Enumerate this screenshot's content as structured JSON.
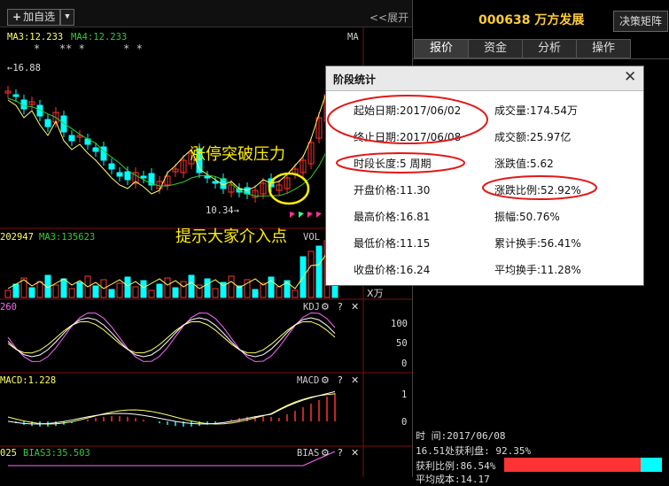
{
  "toolbar": {
    "add_watch_label": "加自选",
    "add_watch_icon": "plus-icon",
    "expand_label": "<<展开"
  },
  "stock": {
    "code": "000638",
    "name": "万方发展",
    "decision_button": "决策矩阵"
  },
  "tabs": [
    "报价",
    "资金",
    "分析",
    "操作"
  ],
  "chart": {
    "ma_labels": {
      "ma3": "MA3:12.233",
      "ma4": "MA4:12.233",
      "ma_tag": "MA"
    },
    "markers": "*   ** *      * *",
    "high_label": "16.88",
    "low_label": "10.34",
    "vol_tag": "VOL",
    "vol_left": "202947",
    "vol_ma3": "MA3:135623",
    "vol_unit": "X万",
    "kdj_left": "260",
    "kdj_tag": "KDJ",
    "kdj_scale": [
      "100",
      "50",
      "0"
    ],
    "macd_left": "MACD:1.228",
    "macd_tag": "MACD",
    "macd_scale": [
      "1",
      "0"
    ],
    "bias_left": "025",
    "bias3": "BIAS3:35.503",
    "bias_tag": "BIAS",
    "ctl_icons": [
      "gear-icon",
      "help-icon",
      "close-icon"
    ],
    "ctl_glyphs": {
      "help": "?",
      "close": "✕"
    },
    "colors": {
      "up": "#ff3333",
      "down": "#00ffff",
      "ma_a": "#ffff66",
      "ma_b": "#33cc33"
    }
  },
  "annotations": {
    "breakout": "涨停突破压力",
    "entry": "提示大家介入点"
  },
  "popup": {
    "title": "阶段统计",
    "start_date": "起始日期:2017/06/02",
    "end_date": "终止日期:2017/06/08",
    "period": "时段长度:5 周期",
    "open": "开盘价格:11.30",
    "high": "最高价格:16.81",
    "low": "最低价格:11.15",
    "close": "收盘价格:16.24",
    "volume": "成交量:174.54万",
    "amount": "成交额:25.97亿",
    "change": "涨跌值:5.62",
    "change_pct": "涨跌比例:52.92%",
    "amplitude": "振幅:50.76%",
    "cum_turnover": "累计换手:56.41%",
    "avg_turnover": "平均换手:11.28%"
  },
  "bottom": {
    "time_label": "时        间:2017/06/08",
    "profit_line": "16.51处获利盘: 92.35%",
    "profit_ratio": "获利比例:86.54%",
    "profit_fraction": 0.8654,
    "avg_cost": "平均成本:14.17"
  }
}
